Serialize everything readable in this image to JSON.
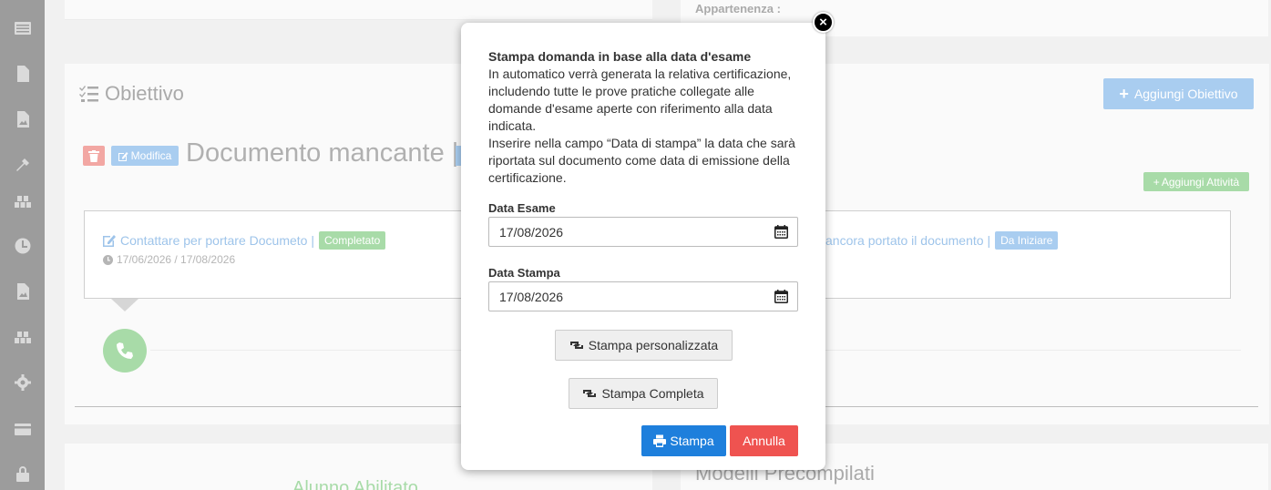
{
  "background": {
    "top_right_label": "Appartenenza :",
    "objective_title": "Obiettivo",
    "add_objective_button": "Aggiungi Obiettivo",
    "modify_button": "Modifica",
    "document_title": "Documento mancante |",
    "add_activity_button": "Aggiungi Attività",
    "task_left": {
      "title": "Contattare per portare Documeto |",
      "status": "Completato",
      "dates": "17/06/2026 / 17/08/2026"
    },
    "task_right": {
      "title": "ancora portato il documento |",
      "status": "Da Iniziare"
    },
    "bottom_left_title": "Alunno Abilitato",
    "bottom_right_title": "Modelli Precompilati"
  },
  "modal": {
    "title": "Stampa domanda in base alla data d'esame",
    "description_1": "In automatico verrà generata la relativa certificazione, includendo tutte le prove pratiche collegate alle domande d'esame aperte con riferimento alla data indicata.",
    "description_2": "Inserire nella campo “Data di stampa” la data che sarà riportata sul documento come data di emissione della certificazione.",
    "exam_date_label": "Data Esame",
    "exam_date_value": "17/08/2026",
    "print_date_label": "Data Stampa",
    "print_date_value": "17/08/2026",
    "custom_print_button": "Stampa personalizzata",
    "full_print_button": "Stampa Completa",
    "print_button": "Stampa",
    "cancel_button": "Annulla",
    "close_symbol": "×"
  },
  "colors": {
    "sidebar": "#9c9c9c",
    "primary": "#1e7fdc",
    "danger": "#ef5350",
    "success_faded": "#a8dba8",
    "info_faded": "#a9cdf0"
  }
}
